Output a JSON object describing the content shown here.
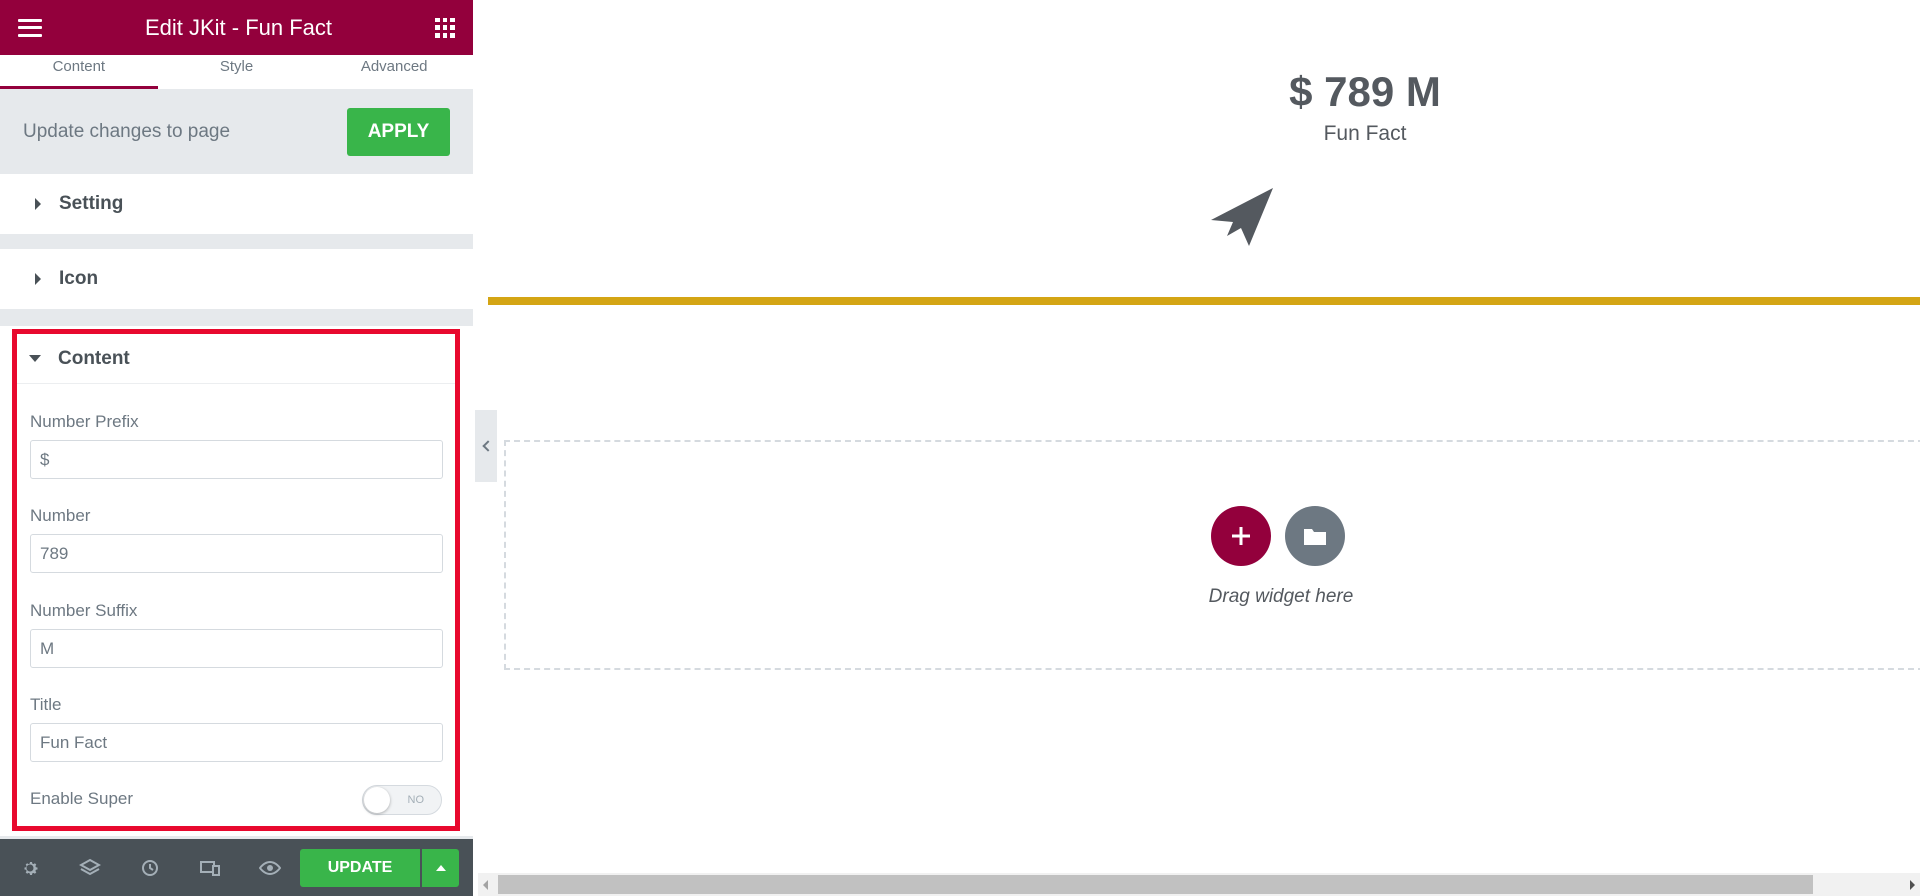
{
  "header": {
    "title": "Edit JKit - Fun Fact"
  },
  "tabs": [
    {
      "label": "Content",
      "active": true
    },
    {
      "label": "Style",
      "active": false
    },
    {
      "label": "Advanced",
      "active": false
    }
  ],
  "apply_bar": {
    "text": "Update changes to page",
    "button_label": "APPLY"
  },
  "sections": [
    {
      "label": "Setting",
      "expanded": false
    },
    {
      "label": "Icon",
      "expanded": false
    },
    {
      "label": "Content",
      "expanded": true
    }
  ],
  "content_fields": {
    "number_prefix": {
      "label": "Number Prefix",
      "value": "$"
    },
    "number": {
      "label": "Number",
      "value": "789"
    },
    "number_suffix": {
      "label": "Number Suffix",
      "value": "M"
    },
    "title": {
      "label": "Title",
      "value": "Fun Fact"
    },
    "enable_super": {
      "label": "Enable Super",
      "toggle_text": "NO",
      "enabled": false
    }
  },
  "footer": {
    "icons": [
      "settings-icon",
      "layers-icon",
      "history-icon",
      "responsive-icon",
      "preview-icon"
    ],
    "update_label": "UPDATE"
  },
  "canvas": {
    "funfact_number": "$ 789 M",
    "funfact_title": "Fun Fact",
    "icon": "paper-plane-icon",
    "drop_text": "Drag widget here"
  },
  "colors": {
    "brand": "#93003c",
    "apply_green": "#39b54a",
    "gold_line": "#d4a514",
    "highlight_red": "#e8092e"
  }
}
